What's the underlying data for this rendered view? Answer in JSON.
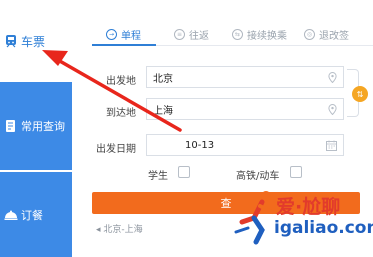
{
  "sidebar": {
    "items": [
      {
        "label": "车票",
        "icon": "train-icon"
      },
      {
        "label": "常用查询",
        "icon": "document-icon"
      },
      {
        "label": "订餐",
        "icon": "meal-icon"
      }
    ]
  },
  "tabs": [
    {
      "label": "单程",
      "icon": "one-way-icon",
      "active": true
    },
    {
      "label": "往返",
      "icon": "round-trip-icon",
      "active": false
    },
    {
      "label": "接续换乘",
      "icon": "transfer-icon",
      "active": false
    },
    {
      "label": "退改签",
      "icon": "refund-icon",
      "active": false
    }
  ],
  "form": {
    "from_label": "出发地",
    "from_value": "北京",
    "to_label": "到达地",
    "to_value": "上海",
    "date_label": "出发日期",
    "date_value": "10-13",
    "student_label": "学生",
    "highspeed_label": "高铁/动车"
  },
  "search_label": "查",
  "history": "北京-上海",
  "watermark": {
    "line1": "爱·尬聊",
    "line2": "igaliao.com"
  },
  "colors": {
    "accent_blue": "#2f7fd6",
    "sidebar_blue": "#3d8ae6",
    "search_orange": "#f26b1d",
    "swap_orange": "#f5a623",
    "arrow_red": "#e8261c"
  }
}
